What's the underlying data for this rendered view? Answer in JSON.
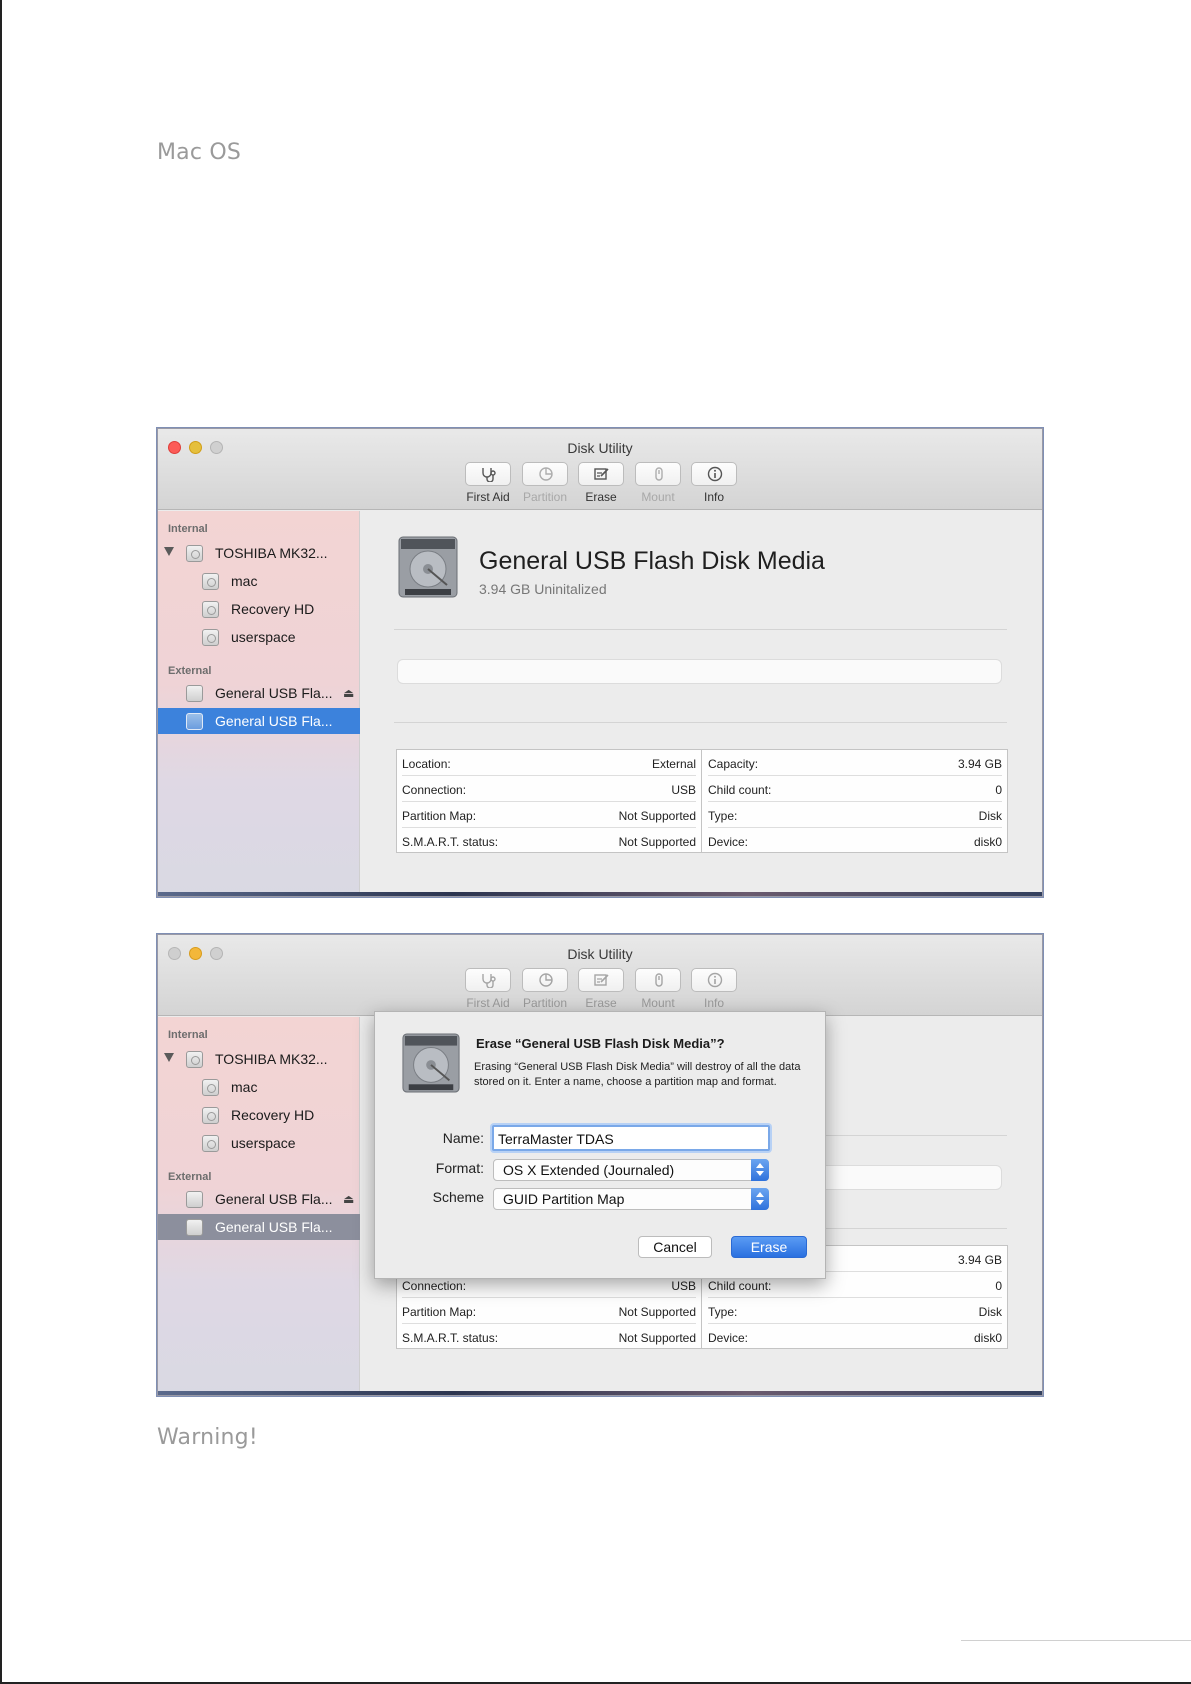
{
  "doc": {
    "heading_mac": "Mac OS",
    "heading_warning": "Warning!"
  },
  "window1": {
    "title": "Disk Utility",
    "toolbar": [
      {
        "label": "First Aid",
        "icon": "stethoscope-icon",
        "enabled": true
      },
      {
        "label": "Partition",
        "icon": "partition-icon",
        "enabled": false
      },
      {
        "label": "Erase",
        "icon": "erase-icon",
        "enabled": true
      },
      {
        "label": "Mount",
        "icon": "mount-icon",
        "enabled": false
      },
      {
        "label": "Info",
        "icon": "info-icon",
        "enabled": true
      }
    ],
    "sidebar": {
      "internal_label": "Internal",
      "external_label": "External",
      "internal_items": [
        "TOSHIBA MK32...",
        "mac",
        "Recovery HD",
        "userspace"
      ],
      "external_items": [
        "General USB Fla...",
        "General USB Fla..."
      ],
      "selected": "General USB Fla..."
    },
    "device": {
      "name": "General USB Flash Disk Media",
      "subtitle": "3.94 GB Uninitalized"
    },
    "info_left": [
      {
        "k": "Location:",
        "v": "External"
      },
      {
        "k": "Connection:",
        "v": "USB"
      },
      {
        "k": "Partition Map:",
        "v": "Not Supported"
      },
      {
        "k": "S.M.A.R.T. status:",
        "v": "Not Supported"
      }
    ],
    "info_right": [
      {
        "k": "Capacity:",
        "v": "3.94 GB"
      },
      {
        "k": "Child count:",
        "v": "0"
      },
      {
        "k": "Type:",
        "v": "Disk"
      },
      {
        "k": "Device:",
        "v": "disk0"
      }
    ]
  },
  "window2": {
    "title": "Disk Utility",
    "toolbar": [
      "First Aid",
      "Partition",
      "Erase",
      "Mount",
      "Info"
    ],
    "sidebar": {
      "internal_label": "Internal",
      "external_label": "External",
      "internal_items": [
        "TOSHIBA MK32...",
        "mac",
        "Recovery HD",
        "userspace"
      ],
      "external_items": [
        "General USB Fla...",
        "General USB Fla..."
      ]
    },
    "capacity_value": "3.94 GB",
    "info_left": [
      {
        "k": "Connection:",
        "v": "USB"
      },
      {
        "k": "Partition Map:",
        "v": "Not Supported"
      },
      {
        "k": "S.M.A.R.T. status:",
        "v": "Not Supported"
      }
    ],
    "info_right": [
      {
        "k": "Child count:",
        "v": "0"
      },
      {
        "k": "Type:",
        "v": "Disk"
      },
      {
        "k": "Device:",
        "v": "disk0"
      }
    ],
    "sheet": {
      "title": "Erase “General USB Flash Disk Media”?",
      "message": "Erasing “General USB Flash Disk Media” will destroy of all the data stored on it. Enter a name, choose a partition map and format.",
      "name_label": "Name:",
      "name_value": "TerraMaster TDAS",
      "format_label": "Format:",
      "format_value": "OS X Extended (Journaled)",
      "scheme_label": "Scheme",
      "scheme_value": "GUID Partition Map",
      "cancel_label": "Cancel",
      "erase_label": "Erase"
    }
  }
}
